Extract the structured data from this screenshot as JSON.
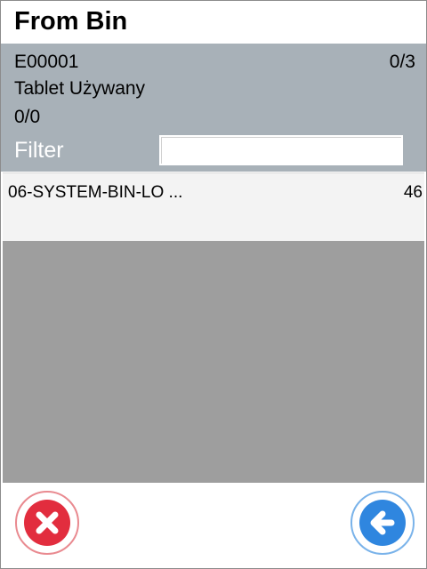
{
  "title": "From Bin",
  "info": {
    "doc_id": "E00001",
    "doc_progress": "0/3",
    "item_name": "Tablet Używany",
    "item_progress": "0/0"
  },
  "filter": {
    "label": "Filter",
    "value": "",
    "placeholder": ""
  },
  "bins": [
    {
      "name": "06-SYSTEM-BIN-LO ...",
      "qty": "46"
    }
  ],
  "actions": {
    "cancel_icon": "close-icon",
    "back_icon": "arrow-left-icon"
  },
  "colors": {
    "info_panel": "#a8b1b8",
    "list_background": "#9e9e9e",
    "cancel": "#e22d3e",
    "back": "#2f86df"
  }
}
